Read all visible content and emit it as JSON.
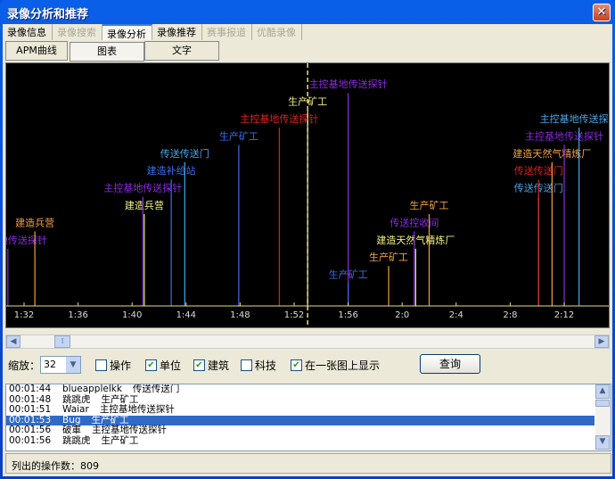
{
  "window": {
    "title": "录像分析和推荐",
    "close_icon": "close-icon"
  },
  "tabs": [
    {
      "label": "录像信息",
      "enabled": true
    },
    {
      "label": "录像搜索",
      "enabled": false
    },
    {
      "label": "录像分析",
      "enabled": true,
      "active": true
    },
    {
      "label": "录像推荐",
      "enabled": true
    },
    {
      "label": "赛事报道",
      "enabled": false
    },
    {
      "label": "优酷录像",
      "enabled": false
    }
  ],
  "subtabs": [
    {
      "label": "APM曲线"
    },
    {
      "label": "图表",
      "active": true
    },
    {
      "label": "文字"
    }
  ],
  "chart_data": {
    "type": "event-timeline",
    "x_ticks": [
      "1:32",
      "1:36",
      "1:40",
      "1:44",
      "1:48",
      "1:52",
      "1:56",
      "2:0",
      "2:4",
      "2:8",
      "2:12"
    ],
    "x_tick_seconds": [
      92,
      96,
      100,
      104,
      108,
      112,
      116,
      120,
      124,
      128,
      132
    ],
    "selected_time_seconds": 113,
    "colors": {
      "axis": "#e8e070",
      "selected_marker": "#e8e070"
    },
    "events": [
      {
        "t": 90.8,
        "label": "主控基地传送探针",
        "color": "#8a2be2"
      },
      {
        "t": 92.8,
        "label": "建造兵营",
        "color": "#f0a040"
      },
      {
        "t": 100.9,
        "label": "建造兵营",
        "color": "#f0f080"
      },
      {
        "t": 100.8,
        "label": "主控基地传送探针",
        "color": "#8a2be2"
      },
      {
        "t": 102.9,
        "label": "建造补给站",
        "color": "#3a6cf0"
      },
      {
        "t": 103.9,
        "label": "传送传送门",
        "color": "#4aa8e8"
      },
      {
        "t": 107.9,
        "label": "生产矿工",
        "color": "#3a6cf0"
      },
      {
        "t": 110.9,
        "label": "主控基地传送探针",
        "color": "#e02020"
      },
      {
        "t": 113.0,
        "label": "生产矿工",
        "color": "#f0f080"
      },
      {
        "t": 116.0,
        "label": "主控基地传送探针",
        "color": "#8a2be2"
      },
      {
        "t": 116.0,
        "label": "生产矿工",
        "color": "#3a6cf0"
      },
      {
        "t": 119.0,
        "label": "生产矿工",
        "color": "#f0a040"
      },
      {
        "t": 121.0,
        "label": "建造天然气精炼厂",
        "color": "#f0f080"
      },
      {
        "t": 120.9,
        "label": "传送控收间",
        "color": "#8a2be2"
      },
      {
        "t": 122.0,
        "label": "生产矿工",
        "color": "#f0a040"
      },
      {
        "t": 130.1,
        "label": "传送传送门",
        "color": "#4aa8e8"
      },
      {
        "t": 130.1,
        "label": "传送传送门",
        "color": "#e02020"
      },
      {
        "t": 131.1,
        "label": "建造天然气精炼厂",
        "color": "#f0a040"
      },
      {
        "t": 132.0,
        "label": "主控基地传送探针",
        "color": "#8a2be2"
      },
      {
        "t": 133.1,
        "label": "主控基地传送探针",
        "color": "#4aa8e8"
      }
    ]
  },
  "controls": {
    "zoom_label": "缩放：",
    "zoom_value": "32",
    "checkboxes": [
      {
        "label": "操作",
        "checked": false
      },
      {
        "label": "单位",
        "checked": true
      },
      {
        "label": "建筑",
        "checked": true
      },
      {
        "label": "科技",
        "checked": false
      },
      {
        "label": "在一张图上显示",
        "checked": true
      }
    ],
    "query_button": "查询"
  },
  "list": [
    {
      "time": "00:01:44",
      "player": "blueapplelkk",
      "action": "传送传送门"
    },
    {
      "time": "00:01:48",
      "player": "跳跳虎",
      "action": "生产矿工"
    },
    {
      "time": "00:01:51",
      "player": "Waiar",
      "action": "主控基地传送探针"
    },
    {
      "time": "00:01:53",
      "player": "Bug",
      "action": "生产矿工",
      "selected": true
    },
    {
      "time": "00:01:56",
      "player": "破軍",
      "action": "主控基地传送探针"
    },
    {
      "time": "00:01:56",
      "player": "跳跳虎",
      "action": "生产矿工"
    }
  ],
  "status": {
    "label": "列出的操作数：",
    "count": "809"
  }
}
